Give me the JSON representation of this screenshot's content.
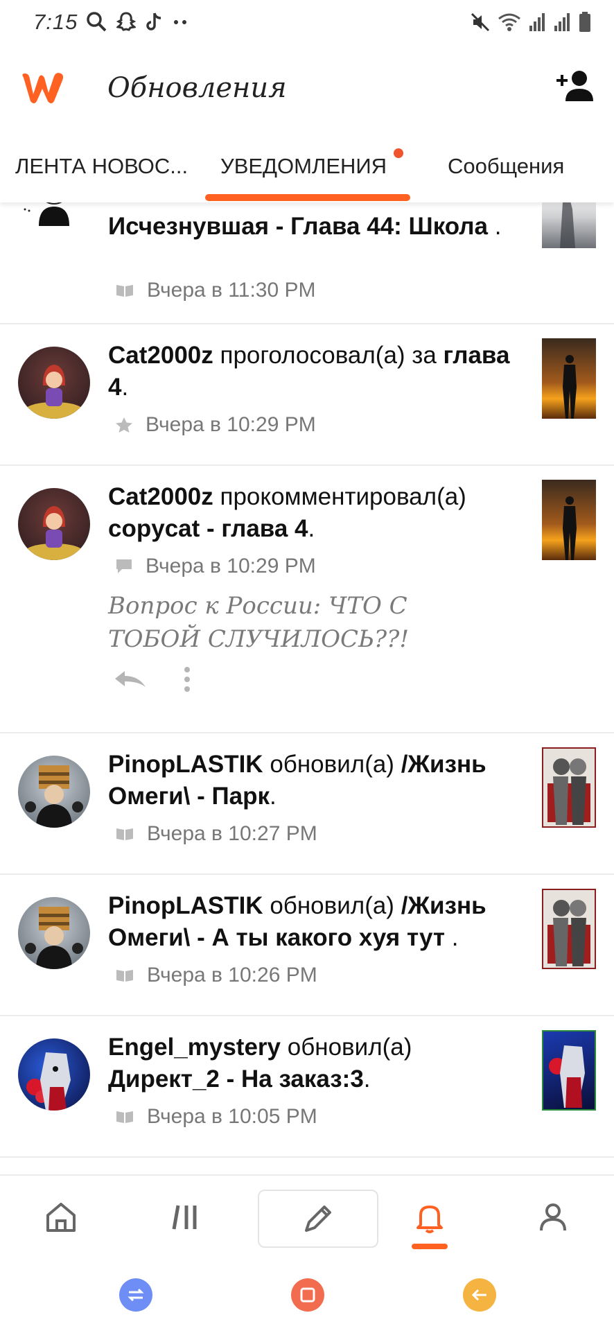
{
  "status_bar": {
    "time": "7:15",
    "left_icons": [
      "search-icon",
      "snapchat-icon",
      "tiktok-icon",
      "more-dots-icon"
    ],
    "right_icons": [
      "mute-icon",
      "wifi-icon",
      "signal-icon",
      "signal-icon",
      "battery-icon"
    ]
  },
  "app_bar": {
    "logo": "wattpad-logo",
    "title": "Обновления",
    "action_icon": "add-friend-icon"
  },
  "tabs": [
    {
      "label": "ЛЕНТА НОВОС...",
      "active": false
    },
    {
      "label": "УВЕДОМЛЕНИЯ",
      "active": true,
      "badge_dot": true
    },
    {
      "label": "Сообщения",
      "active": false
    }
  ],
  "notifications": [
    {
      "user": "",
      "action": "",
      "story": "Исчезнувшая - Глава 44: Школа",
      "suffix": " .",
      "meta_icon": "book-icon",
      "time": "Вчера в 11:30 PM"
    },
    {
      "user": "Cat2000z",
      "action": " проголосовал(а) за ",
      "story": "глава 4",
      "suffix": ".",
      "meta_icon": "star-icon",
      "time": "Вчера в 10:29 PM"
    },
    {
      "user": "Cat2000z",
      "action": " прокомментировал(а) ",
      "story": "copycat - глава 4",
      "suffix": ".",
      "meta_icon": "comment-icon",
      "time": "Вчера в 10:29 PM",
      "comment": "Вопрос к России: ЧТО С ТОБОЙ СЛУЧИЛОСЬ??!"
    },
    {
      "user": "PinopLASTIK",
      "action": " обновил(а) ",
      "story": "/Жизнь Омеги\\ - Парк",
      "suffix": ".",
      "meta_icon": "book-icon",
      "time": "Вчера в 10:27 PM"
    },
    {
      "user": "PinopLASTIK",
      "action": " обновил(а) ",
      "story": "/Жизнь Омеги\\ - А ты какого хуя тут",
      "suffix": " .",
      "meta_icon": "book-icon",
      "time": "Вчера в 10:26 PM"
    },
    {
      "user": "Engel_mystery",
      "action": " обновил(а) ",
      "story": "Директ_2 - На заказ:3",
      "suffix": ".",
      "meta_icon": "book-icon",
      "time": "Вчера в 10:05 PM"
    }
  ],
  "bottom_nav": [
    {
      "icon": "home-icon",
      "active": false
    },
    {
      "icon": "library-icon",
      "active": false
    },
    {
      "icon": "pencil-icon",
      "active": false
    },
    {
      "icon": "bell-icon",
      "active": true
    },
    {
      "icon": "profile-icon",
      "active": false
    }
  ],
  "colors": {
    "accent": "#ff6122",
    "text": "#121212",
    "meta": "#777777",
    "divider": "#ececec"
  }
}
